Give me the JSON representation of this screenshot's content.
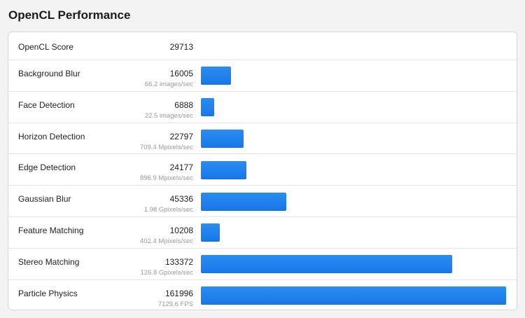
{
  "page": {
    "title": "OpenCL Performance"
  },
  "colors": {
    "bar": "#1e80ee",
    "background": "#f3f3f3",
    "card": "#ffffff"
  },
  "chart_data": {
    "type": "bar",
    "orientation": "horizontal",
    "summary": {
      "name": "OpenCL Score",
      "score": "29713"
    },
    "categories": [
      "Background Blur",
      "Face Detection",
      "Horizon Detection",
      "Edge Detection",
      "Gaussian Blur",
      "Feature Matching",
      "Stereo Matching",
      "Particle Physics"
    ],
    "values": [
      16005,
      6888,
      22797,
      24177,
      45336,
      10208,
      133372,
      161996
    ],
    "rates": [
      "66.2 images/sec",
      "22.5 images/sec",
      "709.4 Mpixels/sec",
      "896.9 Mpixels/sec",
      "1.98 Gpixels/sec",
      "402.4 Mpixels/sec",
      "126.8 Gpixels/sec",
      "7129.6 FPS"
    ],
    "xlim": [
      0,
      161996
    ],
    "grid": false,
    "legend": "none"
  }
}
